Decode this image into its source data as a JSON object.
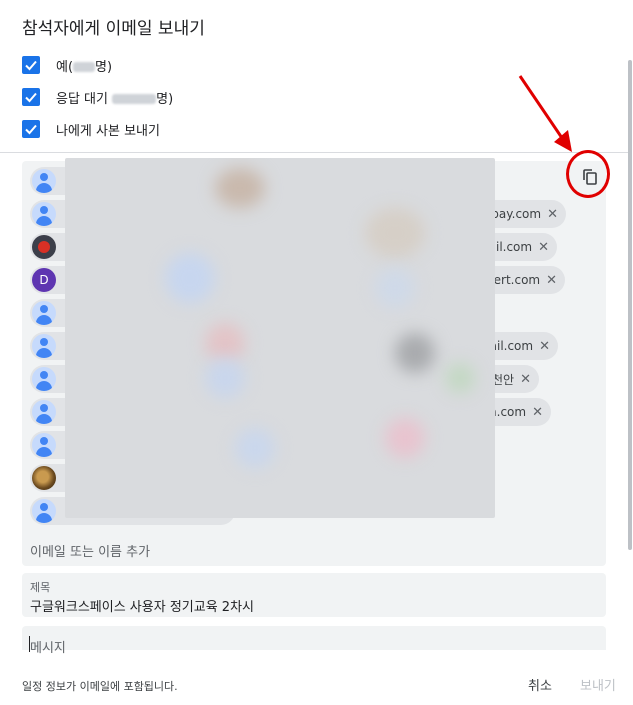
{
  "dialog": {
    "title": "참석자에게 이메일 보내기"
  },
  "options": [
    {
      "label": "예(",
      "suffix": "명)",
      "checked": true
    },
    {
      "label": "응답 대기 ",
      "suffix": "명)",
      "checked": true
    },
    {
      "label": "나에게 사본 보내기",
      "checked": true
    }
  ],
  "recipients": [
    {
      "avatar": "person",
      "text": ""
    },
    {
      "avatar": "person",
      "text": "pay.com"
    },
    {
      "avatar": "logo",
      "text": "ail.com"
    },
    {
      "avatar": "letter",
      "letter": "D",
      "text": "cert.com"
    },
    {
      "avatar": "person",
      "text": ""
    },
    {
      "avatar": "person",
      "text": "ail.com"
    },
    {
      "avatar": "person",
      "text": "천안"
    },
    {
      "avatar": "person",
      "text": "n.com"
    },
    {
      "avatar": "person",
      "text": ""
    },
    {
      "avatar": "photo",
      "text": ""
    },
    {
      "avatar": "person",
      "text": ""
    }
  ],
  "remove_glyph": "✕",
  "add_recipient_placeholder": "이메일 또는 이름 추가",
  "subject": {
    "label": "제목",
    "value": "구글워크스페이스 사용자 정기교육 2차시"
  },
  "message": {
    "placeholder": "메시지"
  },
  "footer": {
    "note": "일정 정보가 이메일에 포함됩니다.",
    "cancel": "취소",
    "send": "보내기"
  },
  "colors": {
    "accent": "#1a73e8",
    "annotation": "#e00000"
  }
}
